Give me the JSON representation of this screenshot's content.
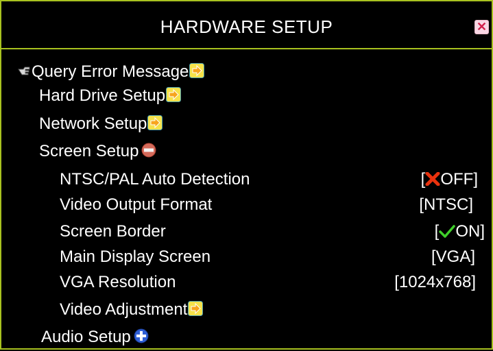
{
  "window": {
    "title": "HARDWARE SETUP",
    "close_icon": "close-icon",
    "border_color": "#a8c21f"
  },
  "menu": {
    "items": [
      {
        "label": "Query Error Message",
        "icon": "arrow-right-icon",
        "selected": true
      },
      {
        "label": "Hard Drive Setup",
        "icon": "arrow-right-icon"
      },
      {
        "label": "Network Setup",
        "icon": "arrow-right-icon"
      },
      {
        "label": "Screen Setup",
        "icon": "collapse-minus-icon"
      },
      {
        "label": "Audio Setup",
        "icon": "expand-plus-icon"
      }
    ],
    "screen_setup": [
      {
        "label": "NTSC/PAL Auto Detection",
        "value": "OFF",
        "icon": "x-mark-icon"
      },
      {
        "label": "Video Output Format",
        "value": "[NTSC]"
      },
      {
        "label": "Screen Border",
        "value": "ON",
        "icon": "check-icon"
      },
      {
        "label": "Main Display Screen",
        "value": "[VGA]"
      },
      {
        "label": "VGA Resolution",
        "value": "[1024x768]"
      },
      {
        "label": "Video Adjustment",
        "icon": "arrow-right-icon"
      }
    ]
  }
}
